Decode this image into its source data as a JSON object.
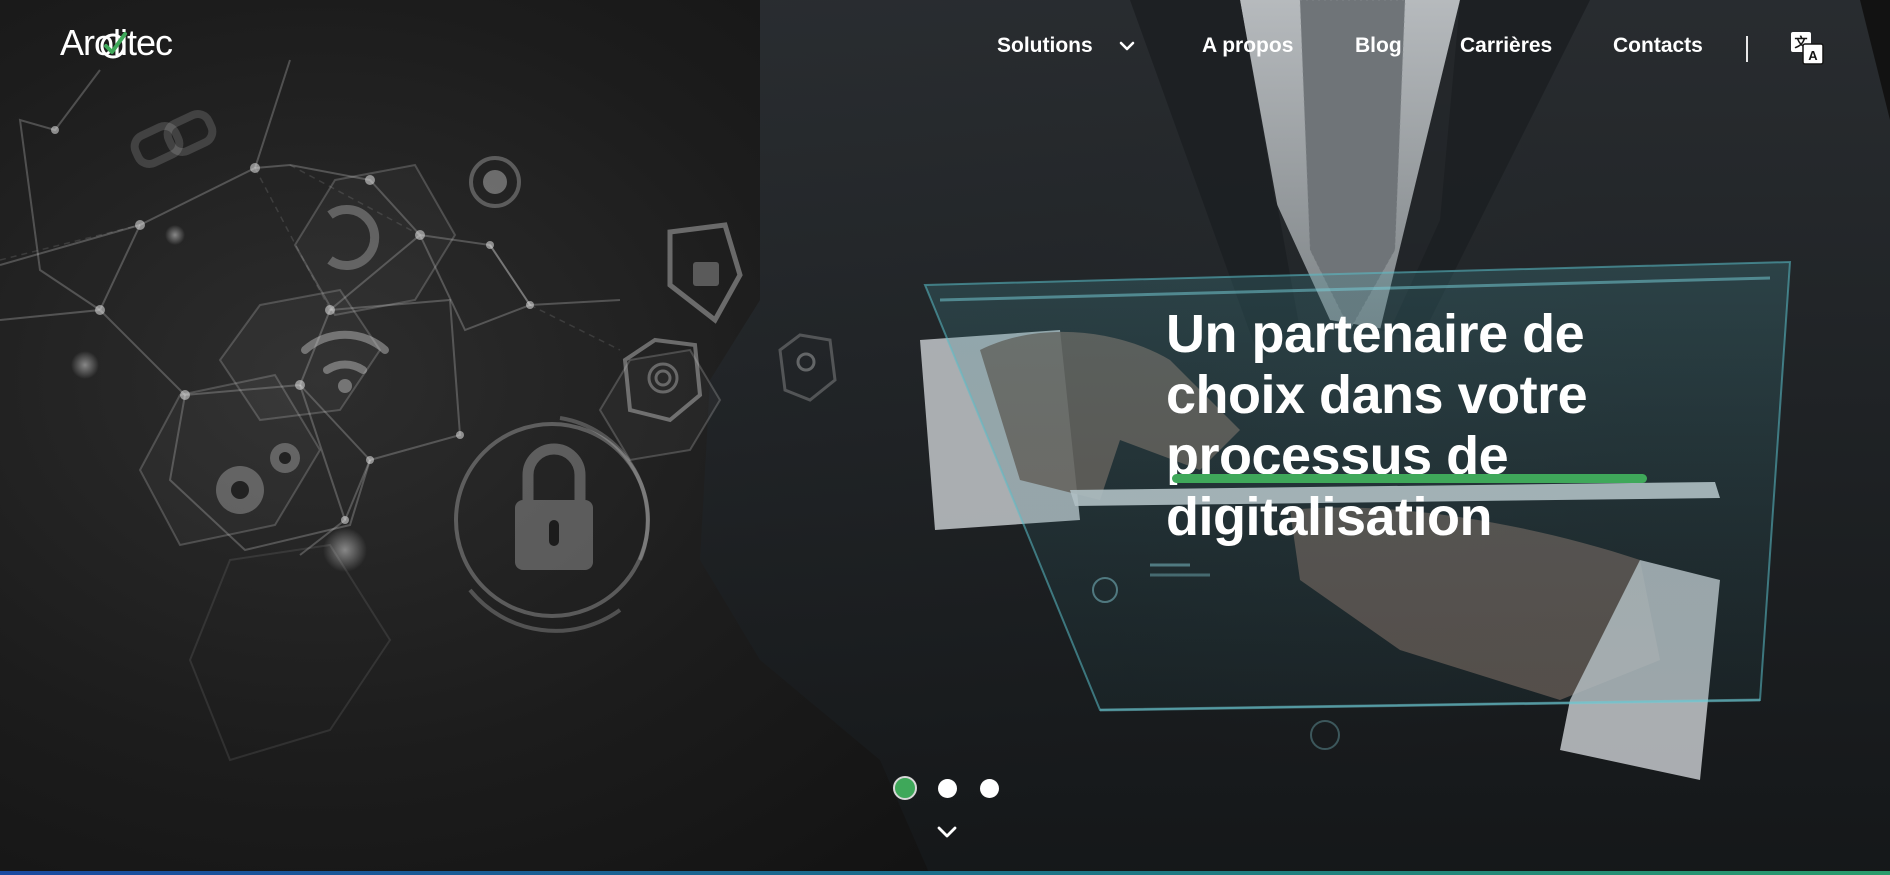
{
  "brand": {
    "logo_text": "Arolitec",
    "accent_color": "#3fa85a"
  },
  "nav": {
    "items": [
      {
        "label": "Solutions",
        "has_dropdown": true
      },
      {
        "label": "A propos"
      },
      {
        "label": "Blog"
      },
      {
        "label": "Carrières"
      },
      {
        "label": "Contacts"
      }
    ],
    "language_icon": "translate-icon"
  },
  "hero": {
    "headline_lines": [
      "Un partenaire de",
      "choix dans votre",
      "processus de",
      "digitalisation"
    ]
  },
  "carousel": {
    "slide_count": 3,
    "active_index": 0
  },
  "icons": {
    "scroll_down": "chevron-down-icon",
    "solutions_dropdown": "chevron-down-icon"
  }
}
